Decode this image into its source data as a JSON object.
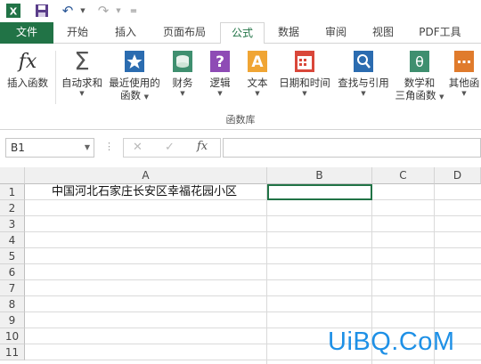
{
  "titlebar": {
    "app_icon_letter": "X",
    "undo_glyph": "↶",
    "redo_glyph": "↷",
    "customize_glyph": "="
  },
  "tabs": [
    {
      "label": "文件"
    },
    {
      "label": "开始"
    },
    {
      "label": "插入"
    },
    {
      "label": "页面布局"
    },
    {
      "label": "公式"
    },
    {
      "label": "数据"
    },
    {
      "label": "审阅"
    },
    {
      "label": "视图"
    },
    {
      "label": "PDF工具"
    }
  ],
  "ribbon": {
    "insert_function": {
      "label": "插入函数",
      "icon_text": "fx"
    },
    "autosum": {
      "label": "自动求和",
      "icon_text": "Σ"
    },
    "recent": {
      "label1": "最近使用的",
      "label2": "函数"
    },
    "financial": {
      "label": "财务"
    },
    "logical": {
      "label": "逻辑",
      "icon_text": "?"
    },
    "text": {
      "label": "文本",
      "icon_text": "A"
    },
    "datetime": {
      "label": "日期和时间"
    },
    "lookup": {
      "label": "查找与引用"
    },
    "math": {
      "label1": "数学和",
      "label2": "三角函数",
      "icon_text": "θ"
    },
    "other": {
      "label": "其他函"
    },
    "group_label": "函数库"
  },
  "formula_bar": {
    "name_box": "B1",
    "cancel_glyph": "✕",
    "enter_glyph": "✓",
    "fx_label": "fx",
    "formula": ""
  },
  "grid": {
    "columns": [
      "A",
      "B",
      "C",
      "D"
    ],
    "rows": [
      "1",
      "2",
      "3",
      "4",
      "5",
      "6",
      "7",
      "8",
      "9",
      "10",
      "11"
    ],
    "cell_A1": "中国河北石家庄长安区幸福花园小区"
  },
  "watermark": "UiBQ.CoM",
  "colors": {
    "excel_green": "#217346",
    "watermark_blue": "#1e90e6"
  }
}
